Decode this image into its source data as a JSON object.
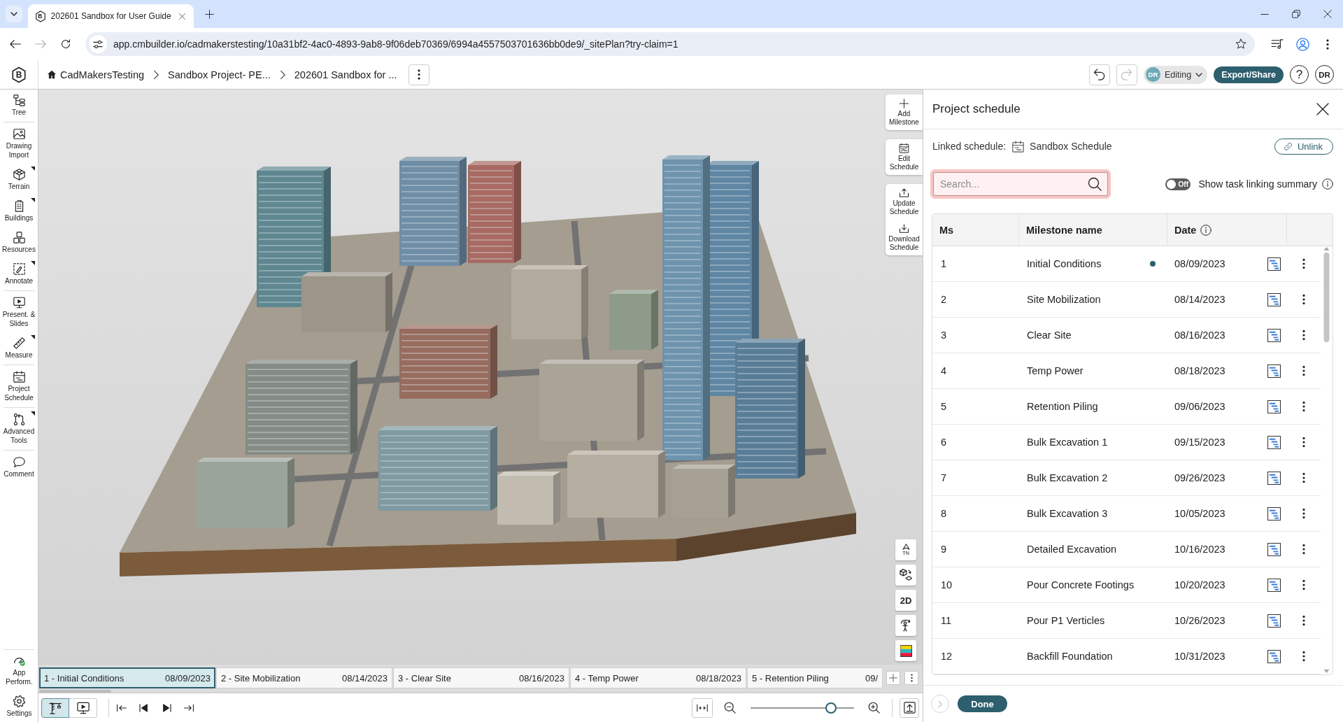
{
  "browser": {
    "tab": {
      "favicon": "B",
      "title": "202601 Sandbox for User Guide"
    },
    "nav": [
      {
        "kind": "back",
        "disabled": false
      },
      {
        "kind": "forward",
        "disabled": true
      },
      {
        "kind": "reload",
        "disabled": false
      }
    ],
    "url": "app.cmbuilder.io/cadmakerstesting/10a31bf2-4ac0-4893-9ab8-9f06deb70369/6994a4557503701636bb0de9/_sitePlan?try-claim=1"
  },
  "toolbar": {
    "logo": "B",
    "breadcrumbs": [
      {
        "kind": "home",
        "label": "CadMakersTesting"
      },
      {
        "kind": "page",
        "label": "Sandbox Project- PE..."
      },
      {
        "kind": "page",
        "label": "202601 Sandbox for ..."
      }
    ],
    "history": [
      {
        "kind": "undo",
        "disabled": false
      },
      {
        "kind": "redo",
        "disabled": true
      }
    ],
    "mode": {
      "avatar": "DR",
      "label": "Editing"
    },
    "export_button": "Export/Share",
    "help": "?",
    "user_avatar": "DR"
  },
  "sidebar": {
    "groups": [
      {
        "items": [
          {
            "kind": "tree",
            "label": "Tree",
            "submenu": false
          }
        ]
      },
      {
        "items": [
          {
            "kind": "drawing",
            "label": "Drawing Import",
            "submenu": false
          },
          {
            "kind": "terrain",
            "label": "Terrain",
            "submenu": true
          },
          {
            "kind": "buildings",
            "label": "Buildings",
            "submenu": true
          },
          {
            "kind": "resources",
            "label": "Resources",
            "submenu": false
          },
          {
            "kind": "annotate",
            "label": "Annotate",
            "submenu": true
          }
        ]
      },
      {
        "items": [
          {
            "kind": "slides",
            "label": "Present. & Slides",
            "submenu": false
          },
          {
            "kind": "measure",
            "label": "Measure",
            "submenu": true
          }
        ]
      },
      {
        "items": [
          {
            "kind": "schedule",
            "label": "Project Schedule",
            "submenu": false
          }
        ]
      },
      {
        "items": [
          {
            "kind": "advanced",
            "label": "Advanced Tools",
            "submenu": true
          }
        ]
      },
      {
        "items": [
          {
            "kind": "comment",
            "label": "Comment",
            "submenu": false
          }
        ]
      }
    ],
    "bottom_items": [
      {
        "kind": "performance",
        "label": "App Perform.",
        "submenu": false
      },
      {
        "kind": "settings",
        "label": "Settings",
        "submenu": false
      }
    ]
  },
  "viewport": {
    "schedule_actions": [
      {
        "items": [
          {
            "kind": "add",
            "label": "Add Milestone"
          }
        ]
      },
      {
        "items": [
          {
            "kind": "edit",
            "label": "Edit Schedule"
          }
        ]
      },
      {
        "items": [
          {
            "kind": "update",
            "label": "Update Schedule"
          },
          {
            "kind": "download",
            "label": "Download Schedule"
          }
        ]
      }
    ],
    "view_buttons": [
      {
        "kind": "north",
        "text": "TN"
      },
      {
        "kind": "cube_plane"
      },
      {
        "kind": "text",
        "text": "2D"
      },
      {
        "kind": "person"
      },
      {
        "kind": "legend"
      }
    ]
  },
  "timeline": {
    "milestones": [
      {
        "label": "1 - Initial Conditions",
        "date": "08/09/2023",
        "selected": true
      },
      {
        "label": "2 - Site Mobilization",
        "date": "08/14/2023",
        "selected": false
      },
      {
        "label": "3 - Clear Site",
        "date": "08/16/2023",
        "selected": false
      },
      {
        "label": "4 - Temp Power",
        "date": "08/18/2023",
        "selected": false
      },
      {
        "label": "5 - Retention Piling",
        "date": "09/",
        "selected": false
      }
    ]
  },
  "controls": {
    "view_modes": [
      {
        "kind": "crane",
        "selected": true
      },
      {
        "kind": "slides",
        "selected": false
      }
    ],
    "zoom": {
      "level": 0.78
    }
  },
  "schedule_panel": {
    "title": "Project schedule",
    "linked_schedule": {
      "label": "Linked schedule:",
      "name": "Sandbox Schedule"
    },
    "unlink_button": "Unlink",
    "search": {
      "placeholder": "Search...",
      "focused": true
    },
    "toggle": {
      "on": false,
      "text": "Off",
      "label": "Show task linking summary"
    },
    "table": {
      "columns": [
        {
          "label": "Ms",
          "info": false
        },
        {
          "label": "Milestone name",
          "info": false
        },
        {
          "label": "Date",
          "info": true
        }
      ],
      "rows": [
        {
          "ms": "1",
          "name": "Initial Conditions",
          "current": true,
          "date": "08/09/2023"
        },
        {
          "ms": "2",
          "name": "Site Mobilization",
          "current": false,
          "date": "08/14/2023"
        },
        {
          "ms": "3",
          "name": "Clear Site",
          "current": false,
          "date": "08/16/2023"
        },
        {
          "ms": "4",
          "name": "Temp Power",
          "current": false,
          "date": "08/18/2023"
        },
        {
          "ms": "5",
          "name": "Retention Piling",
          "current": false,
          "date": "09/06/2023"
        },
        {
          "ms": "6",
          "name": "Bulk Excavation 1",
          "current": false,
          "date": "09/15/2023"
        },
        {
          "ms": "7",
          "name": "Bulk Excavation 2",
          "current": false,
          "date": "09/26/2023"
        },
        {
          "ms": "8",
          "name": "Bulk Excavation 3",
          "current": false,
          "date": "10/05/2023"
        },
        {
          "ms": "9",
          "name": "Detailed Excavation",
          "current": false,
          "date": "10/16/2023"
        },
        {
          "ms": "10",
          "name": "Pour Concrete Footings",
          "current": false,
          "date": "10/20/2023"
        },
        {
          "ms": "11",
          "name": "Pour P1 Verticles",
          "current": false,
          "date": "10/26/2023"
        },
        {
          "ms": "12",
          "name": "Backfill Foundation",
          "current": false,
          "date": "10/31/2023"
        }
      ]
    },
    "done_button": "Done"
  }
}
